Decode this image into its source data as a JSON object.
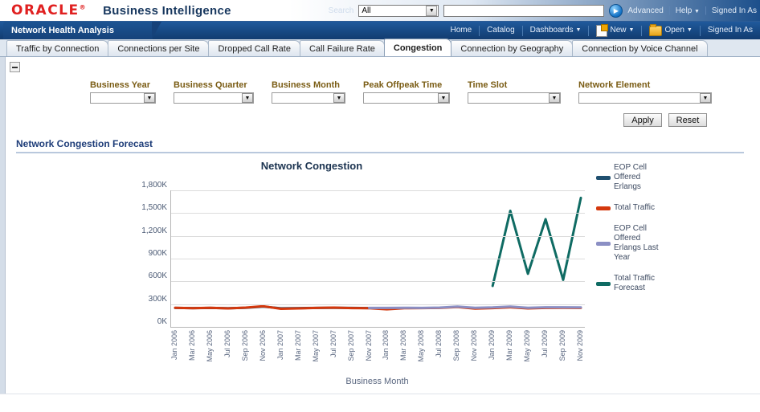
{
  "header": {
    "logo": "ORACLE",
    "logo_tm": "®",
    "product": "Business Intelligence",
    "search_label": "Search",
    "search_scope": "All",
    "search_value": "",
    "search_placeholder": "",
    "go_icon": "play-icon",
    "advanced": "Advanced",
    "help": "Help",
    "signed_in": "Signed In As"
  },
  "navbar": {
    "page_tab": "Network Health Analysis",
    "items": [
      {
        "label": "Home",
        "icon": null,
        "caret": false
      },
      {
        "label": "Catalog",
        "icon": null,
        "caret": false
      },
      {
        "label": "Dashboards",
        "icon": null,
        "caret": true
      },
      {
        "label": "New",
        "icon": "new-document-icon",
        "caret": true
      },
      {
        "label": "Open",
        "icon": "open-folder-icon",
        "caret": true
      },
      {
        "label": "Signed In As",
        "icon": null,
        "caret": false
      }
    ]
  },
  "tabs": [
    {
      "label": "Traffic by Connection",
      "active": false
    },
    {
      "label": "Connections per Site",
      "active": false
    },
    {
      "label": "Dropped Call Rate",
      "active": false
    },
    {
      "label": "Call Failure Rate",
      "active": false
    },
    {
      "label": "Congestion",
      "active": true
    },
    {
      "label": "Connection by Geography",
      "active": false
    },
    {
      "label": "Connection by Voice Channel",
      "active": false
    }
  ],
  "prompts": {
    "collapse_icon": "minus-box-icon",
    "fields": [
      {
        "label": "Business Year",
        "value": "",
        "width_class": "w-year"
      },
      {
        "label": "Business Quarter",
        "value": "",
        "width_class": "w-quarter"
      },
      {
        "label": "Business Month",
        "value": "",
        "width_class": "w-month"
      },
      {
        "label": "Peak Offpeak Time",
        "value": "",
        "width_class": "w-peak"
      },
      {
        "label": "Time Slot",
        "value": "",
        "width_class": "w-slot"
      },
      {
        "label": "Network Element",
        "value": "",
        "width_class": "w-elem"
      }
    ],
    "apply": "Apply",
    "reset": "Reset"
  },
  "section": {
    "title": "Network Congestion Forecast"
  },
  "chart_data": {
    "type": "line",
    "title": "Network Congestion",
    "xlabel": "Business Month",
    "ylabel": "",
    "ylim": [
      0,
      1800000
    ],
    "ytick_labels": [
      "1,800K",
      "1,500K",
      "1,200K",
      "900K",
      "600K",
      "300K",
      "0K"
    ],
    "ytick_values": [
      1800000,
      1500000,
      1200000,
      900000,
      600000,
      300000,
      0
    ],
    "grid": true,
    "legend_position": "right",
    "categories": [
      "Jan 2006",
      "Mar 2006",
      "May 2006",
      "Jul 2006",
      "Sep 2006",
      "Nov 2006",
      "Jan 2007",
      "Mar 2007",
      "May 2007",
      "Jul 2007",
      "Sep 2007",
      "Nov 2007",
      "Jan 2008",
      "Mar 2008",
      "May 2008",
      "Jul 2008",
      "Sep 2008",
      "Nov 2008",
      "Jan 2009",
      "Mar 2009",
      "May 2009",
      "Jul 2009",
      "Sep 2009",
      "Nov 2009"
    ],
    "series": [
      {
        "name": "EOP Cell Offered Erlangs",
        "color": "#1f4f6f",
        "values": [
          250000,
          248000,
          250000,
          246000,
          252000,
          268000,
          245000,
          248000,
          250000,
          252000,
          250000,
          248000,
          null,
          null,
          null,
          null,
          null,
          null,
          null,
          null,
          null,
          null,
          null,
          null
        ]
      },
      {
        "name": "Total Traffic",
        "color": "#d4380d",
        "values": [
          252000,
          246000,
          252000,
          244000,
          254000,
          272000,
          238000,
          244000,
          250000,
          254000,
          248000,
          246000,
          232000,
          246000,
          248000,
          250000,
          262000,
          240000,
          248000,
          258000,
          244000,
          250000,
          252000,
          250000
        ]
      },
      {
        "name": "EOP Cell Offered Erlangs Last Year",
        "color": "#8b8fc4",
        "values": [
          null,
          null,
          null,
          null,
          null,
          null,
          null,
          null,
          null,
          null,
          null,
          250000,
          250000,
          252000,
          250000,
          254000,
          268000,
          252000,
          256000,
          268000,
          252000,
          258000,
          258000,
          256000
        ]
      },
      {
        "name": "Total Traffic Forecast",
        "color": "#0f6b63",
        "values": [
          null,
          null,
          null,
          null,
          null,
          null,
          null,
          null,
          null,
          null,
          null,
          null,
          null,
          null,
          null,
          null,
          null,
          null,
          540000,
          1530000,
          700000,
          1420000,
          620000,
          1700000
        ]
      }
    ],
    "legend": [
      {
        "label": "EOP Cell Offered Erlangs",
        "color": "#1f4f6f"
      },
      {
        "label": "Total Traffic",
        "color": "#d4380d"
      },
      {
        "label": "EOP Cell Offered Erlangs Last Year",
        "color": "#8b8fc4"
      },
      {
        "label": "Total Traffic Forecast",
        "color": "#0f6b63"
      }
    ]
  }
}
